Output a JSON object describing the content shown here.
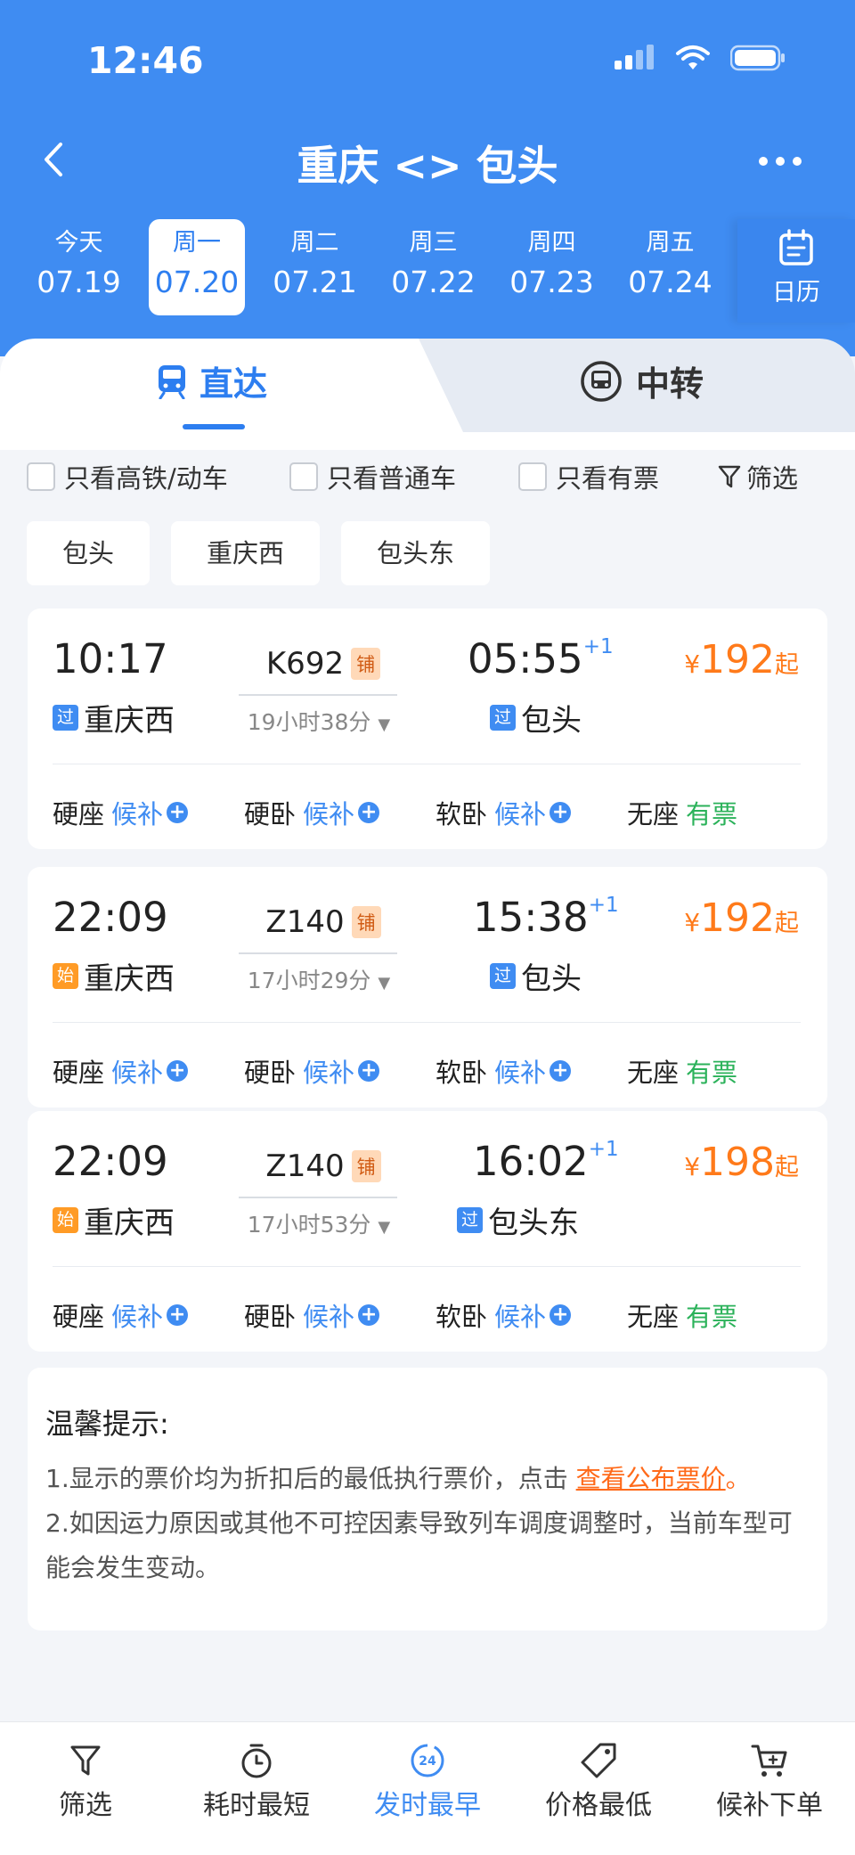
{
  "status_bar": {
    "time": "12:46"
  },
  "nav": {
    "title": "重庆 <> 包头"
  },
  "dates": [
    {
      "weekday": "今天",
      "date": "07.19"
    },
    {
      "weekday": "周一",
      "date": "07.20"
    },
    {
      "weekday": "周二",
      "date": "07.21"
    },
    {
      "weekday": "周三",
      "date": "07.22"
    },
    {
      "weekday": "周四",
      "date": "07.23"
    },
    {
      "weekday": "周五",
      "date": "07.24"
    }
  ],
  "selected_date_index": 1,
  "calendar_label": "日历",
  "tabs": {
    "direct": "直达",
    "transfer": "中转"
  },
  "filters": {
    "high_speed": "只看高铁/动车",
    "normal": "只看普通车",
    "available": "只看有票",
    "filter": "筛选"
  },
  "station_chips": [
    "包头",
    "重庆西",
    "包头东"
  ],
  "trains": [
    {
      "depart_time": "10:17",
      "depart_tag": "过",
      "depart_station": "重庆西",
      "train_no": "K692",
      "bed_tag": "铺",
      "duration": "19小时38分",
      "arrive_time": "05:55",
      "arrive_plus": "+1",
      "arrive_tag": "过",
      "arrive_station": "包头",
      "price_symbol": "¥",
      "price": "192",
      "price_suffix": "起",
      "seats": [
        {
          "name": "硬座",
          "status": "候补"
        },
        {
          "name": "硬卧",
          "status": "候补"
        },
        {
          "name": "软卧",
          "status": "候补"
        },
        {
          "name": "无座",
          "status": "有票"
        }
      ]
    },
    {
      "depart_time": "22:09",
      "depart_tag": "始",
      "depart_station": "重庆西",
      "train_no": "Z140",
      "bed_tag": "铺",
      "duration": "17小时29分",
      "arrive_time": "15:38",
      "arrive_plus": "+1",
      "arrive_tag": "过",
      "arrive_station": "包头",
      "price_symbol": "¥",
      "price": "192",
      "price_suffix": "起",
      "seats": [
        {
          "name": "硬座",
          "status": "候补"
        },
        {
          "name": "硬卧",
          "status": "候补"
        },
        {
          "name": "软卧",
          "status": "候补"
        },
        {
          "name": "无座",
          "status": "有票"
        }
      ]
    },
    {
      "depart_time": "22:09",
      "depart_tag": "始",
      "depart_station": "重庆西",
      "train_no": "Z140",
      "bed_tag": "铺",
      "duration": "17小时53分",
      "arrive_time": "16:02",
      "arrive_plus": "+1",
      "arrive_tag": "过",
      "arrive_station": "包头东",
      "price_symbol": "¥",
      "price": "198",
      "price_suffix": "起",
      "seats": [
        {
          "name": "硬座",
          "status": "候补"
        },
        {
          "name": "硬卧",
          "status": "候补"
        },
        {
          "name": "软卧",
          "status": "候补"
        },
        {
          "name": "无座",
          "status": "有票"
        }
      ]
    }
  ],
  "tips": {
    "title": "温馨提示:",
    "line1": "1.显示的票价均为折扣后的最低执行票价，点击",
    "link": "查看公布票价",
    "line1_end": "。",
    "line2": "2.如因运力原因或其他不可控因素导致列车调度调整时，当前车型可能会发生变动。"
  },
  "bottom_bar": {
    "filter": "筛选",
    "shortest": "耗时最短",
    "earliest": "发时最早",
    "cheapest": "价格最低",
    "waitlist": "候补下单",
    "earliest_icon_text": "24"
  },
  "colors": {
    "header_blue": "#3f8cf2",
    "accent_blue": "#2d7ef0",
    "price_orange": "#ff7a1a",
    "available_green": "#2bb25a"
  }
}
